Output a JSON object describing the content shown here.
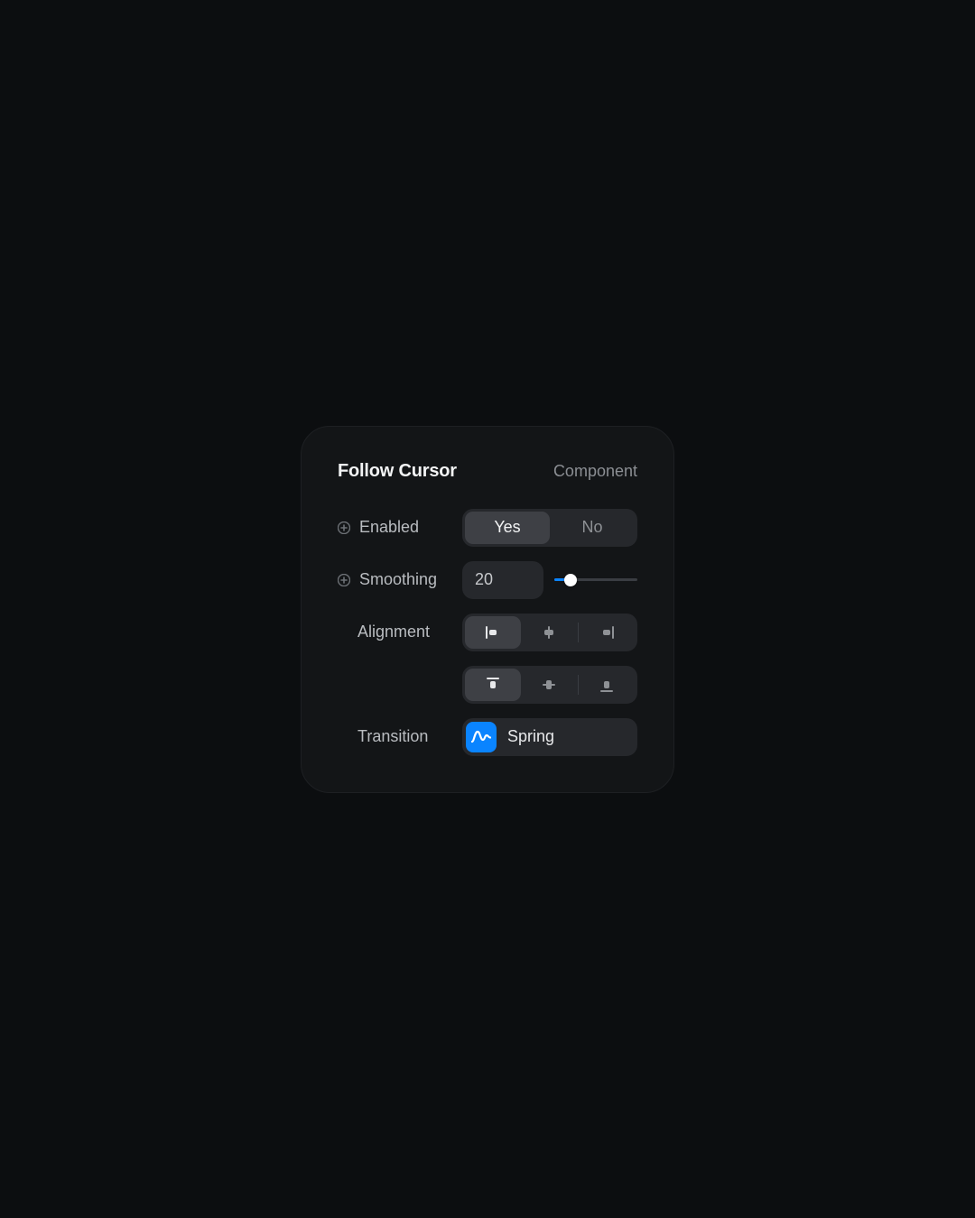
{
  "panel": {
    "title": "Follow Cursor",
    "tag": "Component"
  },
  "enabled": {
    "label": "Enabled",
    "yes": "Yes",
    "no": "No",
    "value": "Yes"
  },
  "smoothing": {
    "label": "Smoothing",
    "value": "20",
    "min": 0,
    "max": 100,
    "percent": 20
  },
  "alignment": {
    "label": "Alignment",
    "horizontal": "left",
    "vertical": "top"
  },
  "transition": {
    "label": "Transition",
    "value": "Spring"
  }
}
